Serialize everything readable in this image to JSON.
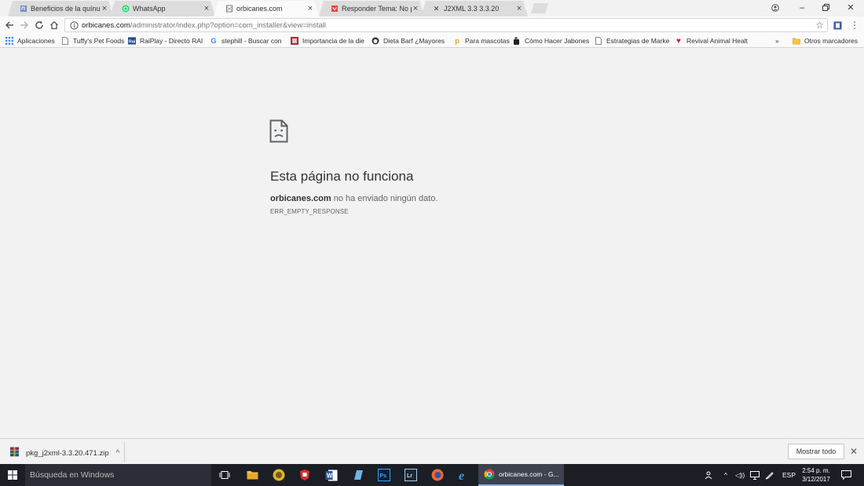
{
  "tabs": [
    {
      "title": "Beneficios de la quínua p",
      "icon": "dog-favicon"
    },
    {
      "title": "WhatsApp",
      "icon": "whatsapp-favicon"
    },
    {
      "title": "orbicanes.com",
      "icon": "broken-page-favicon"
    },
    {
      "title": "Responder Tema: No pue",
      "icon": "forum-favicon"
    },
    {
      "title": "J2XML 3.3 3.3.20",
      "icon": "joomla-favicon"
    }
  ],
  "address": {
    "host": "orbicanes.com",
    "path": "/administrator/index.php?option=com_installer&view=install"
  },
  "bookmarks": [
    {
      "label": "Aplicaciones",
      "icon": "apps-grid-icon"
    },
    {
      "label": "Tuffy's Pet Foods",
      "icon": "page-icon"
    },
    {
      "label": "RaiPlay - Directo RAI",
      "icon": "rai-icon"
    },
    {
      "label": "stephill - Buscar con",
      "icon": "google-icon"
    },
    {
      "label": "Importancia de la die",
      "icon": "site-icon"
    },
    {
      "label": "Dieta Barf ¿Mayores",
      "icon": "dog-icon"
    },
    {
      "label": "Para mascotas",
      "icon": "p-icon"
    },
    {
      "label": "Cómo Hacer Jabones",
      "icon": "soap-icon"
    },
    {
      "label": "Estrategias de Marke",
      "icon": "page-icon"
    },
    {
      "label": "Revival Animal Healt",
      "icon": "heart-icon"
    },
    {
      "label": "»",
      "icon": "chevron"
    },
    {
      "label": "Otros marcadores",
      "icon": "folder-icon"
    }
  ],
  "error": {
    "title": "Esta página no funciona",
    "host": "orbicanes.com",
    "message": " no ha enviado ningún dato.",
    "code": "ERR_EMPTY_RESPONSE"
  },
  "download": {
    "filename": "pkg_j2xml-3.3.20.471.zip",
    "show_all": "Mostrar todo"
  },
  "taskbar": {
    "search_placeholder": "Búsqueda en Windows",
    "chrome_task": "orbicanes.com - G...",
    "language": "ESP",
    "time": "2:54 p. m.",
    "date": "3/12/2017"
  }
}
